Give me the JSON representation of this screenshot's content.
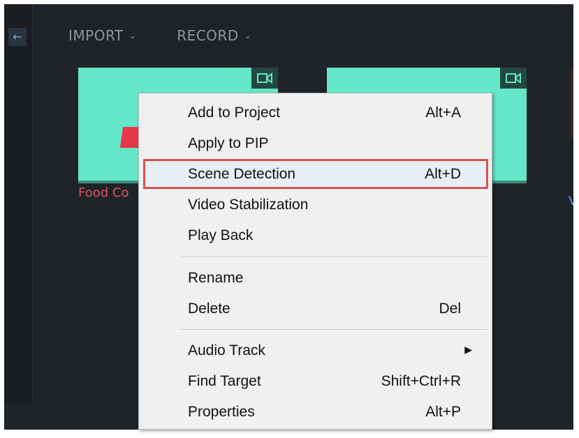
{
  "toolbar": {
    "back_icon": "arrow-left-icon",
    "import_label": "IMPORT",
    "record_label": "RECORD",
    "dropdown_icon": "chevron-down-icon"
  },
  "media": {
    "clip1_label": "Food Co",
    "clip2_label": "V",
    "badge_icon": "video-camera-icon",
    "colors": {
      "thumbnail": "#64e6c8",
      "label_selected": "#e0525f"
    }
  },
  "context_menu": {
    "items": [
      {
        "label": "Add to Project",
        "shortcut": "Alt+A"
      },
      {
        "label": "Apply to PIP",
        "shortcut": ""
      },
      {
        "label": "Scene Detection",
        "shortcut": "Alt+D"
      },
      {
        "label": "Video Stabilization",
        "shortcut": ""
      },
      {
        "label": "Play Back",
        "shortcut": ""
      },
      {
        "label": "Rename",
        "shortcut": ""
      },
      {
        "label": "Delete",
        "shortcut": "Del"
      },
      {
        "label": "Audio Track",
        "shortcut": "",
        "submenu_icon": "triangle-right-icon"
      },
      {
        "label": "Find Target",
        "shortcut": "Shift+Ctrl+R"
      },
      {
        "label": "Properties",
        "shortcut": "Alt+P"
      }
    ],
    "highlight_color": "#d9534f"
  }
}
